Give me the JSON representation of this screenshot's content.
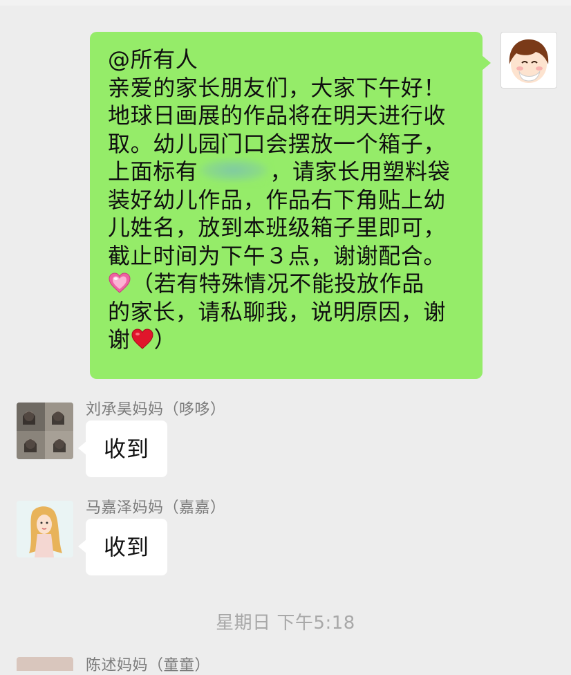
{
  "sent_message": {
    "mention": "@所有人",
    "lines": [
      "亲爱的家长朋友们，大家下午好！",
      "地球日画展的作品将在明天进行收",
      "取。幼儿园门口会摆放一个箱子，"
    ],
    "line4_before": "上面标有",
    "line4_after": "，请家长用塑料袋",
    "lines_after": [
      "装好幼儿作品，作品右下角贴上幼",
      "儿姓名，放到本班级箱子里即可，",
      "截止时间为下午３点，谢谢配合。"
    ],
    "line8_text": "（若有特殊情况不能投放作品",
    "line9_text": "的家长，请私聊我，说明原因，谢",
    "line10_before": "谢",
    "line10_after": "）"
  },
  "messages": [
    {
      "sender": "刘承昊妈妈（哆哆）",
      "text": "收到"
    },
    {
      "sender": "马嘉泽妈妈（嘉嘉）",
      "text": "收到"
    }
  ],
  "timestamp": "星期日 下午5:18",
  "last_sender": "陈述妈妈（童童）",
  "colors": {
    "sent_bubble": "#95ec69",
    "received_bubble": "#ffffff",
    "background": "#ededed"
  },
  "icons": [
    "sparkling-heart-emoji",
    "red-heart-emoji"
  ]
}
